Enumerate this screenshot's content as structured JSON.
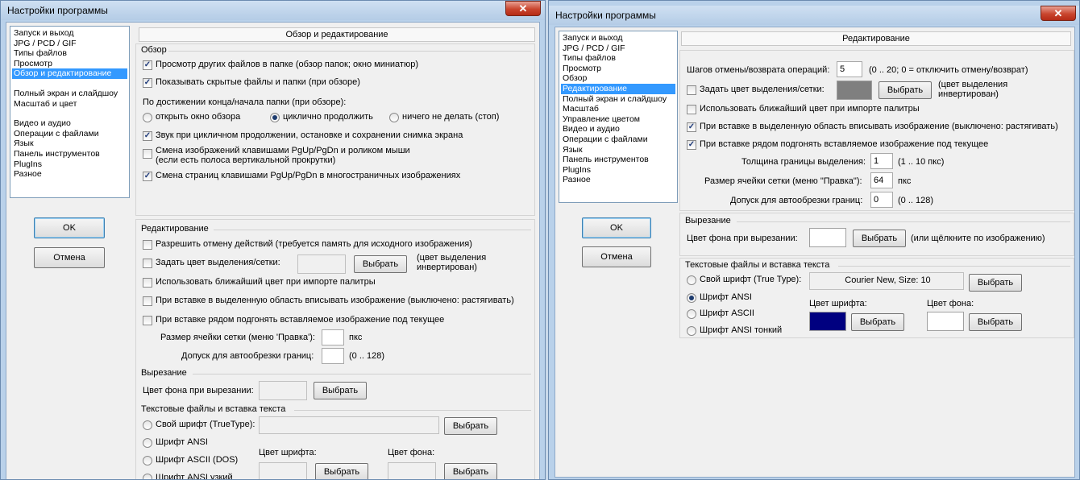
{
  "left": {
    "title": "Настройки программы",
    "close": "✕",
    "nav": [
      "Запуск и выход",
      "JPG / PCD / GIF",
      "Типы файлов",
      "Просмотр",
      "Обзор и редактирование",
      "",
      "Полный экран и слайдшоу",
      "Масштаб и цвет",
      "",
      "Видео и аудио",
      "Операции с файлами",
      "Язык",
      "Панель инструментов",
      "PlugIns",
      "Разное"
    ],
    "ok": "OK",
    "cancel": "Отмена",
    "header": "Обзор и редактирование",
    "browse": {
      "group": "Обзор",
      "cb1": "Просмотр других файлов в папке (обзор папок; окно миниатюр)",
      "cb2": "Показывать скрытые файлы и папки (при обзоре)",
      "end_label": "По достижении конца/начала папки (при обзоре):",
      "r1": "открыть окно обзора",
      "r2": "циклично продолжить",
      "r3": "ничего не делать (стоп)",
      "cb3": "Звук при цикличном продолжении, остановке и сохранении снимка экрана",
      "cb4a": "Смена изображений клавишами PgUp/PgDn и роликом мыши",
      "cb4b": "(если есть полоса вертикальной прокрутки)",
      "cb5": "Смена страниц клавишами PgUp/PgDn в многостраничных изображениях"
    },
    "edit": {
      "group": "Редактирование",
      "cb1": "Разрешить отмену действий (требуется память для исходного изображения)",
      "cb2": "Задать цвет выделения/сетки:",
      "choose": "Выбрать",
      "inv1": "(цвет выделения",
      "inv2": "инвертирован)",
      "cb3": "Использовать ближайший цвет при импорте палитры",
      "cb4": "При вставке в выделенную область вписывать изображение (выключено: растягивать)",
      "cb5": "При вставке рядом подгонять вставляемое изображение под текущее",
      "grid_label": "Размер ячейки сетки (меню 'Правка'):",
      "grid_unit": "пкс",
      "crop_label": "Допуск для автообрезки границ:",
      "crop_range": "(0 .. 128)"
    },
    "cut": {
      "group": "Вырезание",
      "bg_label": "Цвет фона при вырезании:",
      "choose": "Выбрать"
    },
    "text": {
      "group": "Текстовые файлы и вставка текста",
      "r1": "Свой шрифт (TrueType):",
      "r2": "Шрифт ANSI",
      "r3": "Шрифт ASCII (DOS)",
      "r4": "Шрифт ANSI узкий",
      "font_color": "Цвет шрифта:",
      "bg_color": "Цвет фона:",
      "choose": "Выбрать"
    }
  },
  "right": {
    "title": "Настройки программы",
    "close": "✕",
    "nav": [
      "Запуск и выход",
      "JPG / PCD / GIF",
      "Типы файлов",
      "Просмотр",
      "Обзор",
      "Редактирование",
      "Полный экран и слайдшоу",
      "Масштаб",
      "Управление цветом",
      "Видео и аудио",
      "Операции с файлами",
      "Язык",
      "Панель инструментов",
      "PlugIns",
      "Разное"
    ],
    "ok": "OK",
    "cancel": "Отмена",
    "header": "Редактирование",
    "edit": {
      "undo_label": "Шагов отмены/возврата операций:",
      "undo_value": "5",
      "undo_range": "(0 .. 20; 0 = отключить отмену/возврат)",
      "cb1": "Задать цвет выделения/сетки:",
      "choose": "Выбрать",
      "inv1": "(цвет выделения",
      "inv2": "инвертирован)",
      "cb2": "Использовать ближайший цвет при импорте палитры",
      "cb3": "При вставке в выделенную область вписывать изображение (выключено: растягивать)",
      "cb4": "При вставке рядом подгонять вставляемое изображение под текущее",
      "border_label": "Толщина границы выделения:",
      "border_value": "1",
      "border_range": "(1 .. 10 пкс)",
      "grid_label": "Размер ячейки сетки (меню \"Правка\"):",
      "grid_value": "64",
      "grid_unit": "пкс",
      "crop_label": "Допуск для автообрезки границ:",
      "crop_value": "0",
      "crop_range": "(0 .. 128)"
    },
    "cut": {
      "group": "Вырезание",
      "bg_label": "Цвет фона при вырезании:",
      "choose": "Выбрать",
      "hint": "(или щёлкните по изображению)"
    },
    "text": {
      "group": "Текстовые файлы и вставка текста",
      "r1": "Свой шрифт (True Type):",
      "font_value": "Courier New, Size: 10",
      "r2": "Шрифт ANSI",
      "r3": "Шрифт ASCII",
      "r4": "Шрифт ANSI тонкий",
      "font_color": "Цвет шрифта:",
      "bg_color": "Цвет фона:",
      "choose": "Выбрать"
    },
    "colors": {
      "selection": "#7f7f7f",
      "font": "#000080",
      "bg": "#ffffff"
    }
  }
}
